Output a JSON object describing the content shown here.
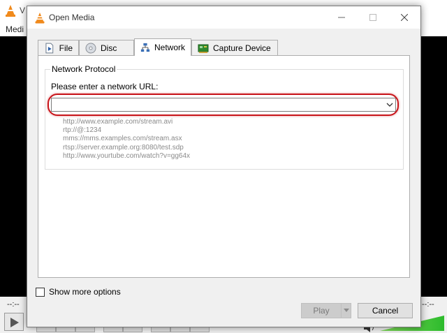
{
  "background": {
    "title_fragment": "V",
    "menu_fragment": "Medi",
    "time_left": "--:--",
    "time_right": "--:--"
  },
  "dialog": {
    "title": "Open Media",
    "icon": "vlc-cone-icon"
  },
  "tabs": [
    {
      "label": "File",
      "icon": "file-icon"
    },
    {
      "label": "Disc",
      "icon": "disc-icon"
    },
    {
      "label": "Network",
      "icon": "network-icon",
      "active": true
    },
    {
      "label": "Capture Device",
      "icon": "capture-card-icon"
    }
  ],
  "network": {
    "group_title": "Network Protocol",
    "url_label": "Please enter a network URL:",
    "url_value": "",
    "examples": [
      "http://www.example.com/stream.avi",
      "rtp://@:1234",
      "mms://mms.examples.com/stream.asx",
      "rtsp://server.example.org:8080/test.sdp",
      "http://www.yourtube.com/watch?v=gg64x"
    ]
  },
  "footer": {
    "show_more_label": "Show more options",
    "show_more_checked": false,
    "play_label": "Play",
    "cancel_label": "Cancel"
  },
  "colors": {
    "highlight": "#c8141a",
    "vlc_orange": "#f08a1c"
  }
}
